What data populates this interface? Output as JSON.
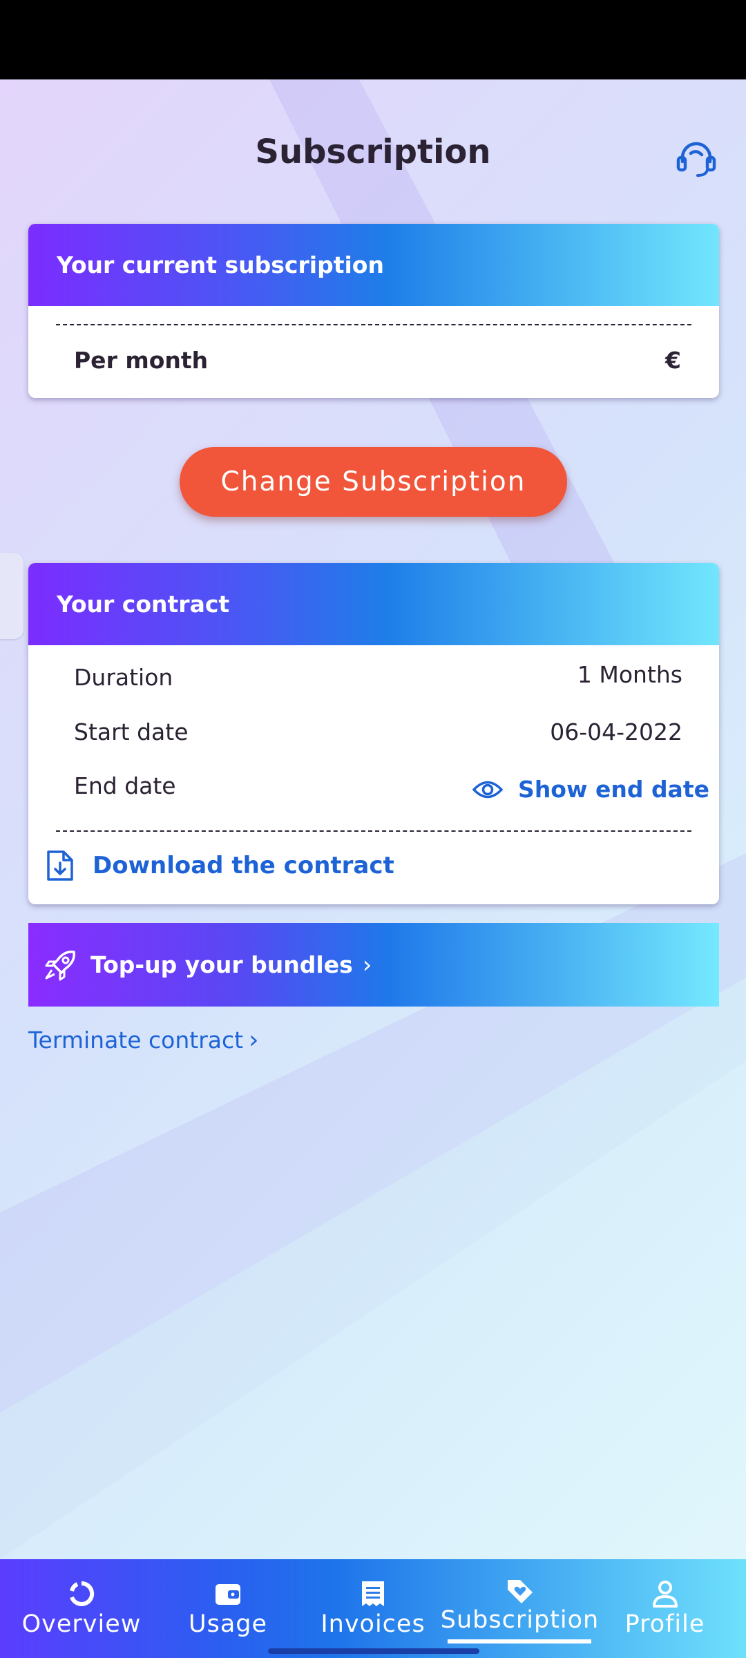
{
  "header": {
    "title": "Subscription",
    "support_icon": "headset-icon"
  },
  "current_subscription": {
    "heading": "Your current subscription",
    "per_month_label": "Per month",
    "per_month_value": "€"
  },
  "change_button": {
    "label": "Change Subscription"
  },
  "contract": {
    "heading": "Your contract",
    "duration_label": "Duration",
    "duration_value": "1 Months",
    "start_label": "Start date",
    "start_value": "06-04-2022",
    "end_label": "End date",
    "show_end_label": "Show end date",
    "download_label": "Download the contract"
  },
  "topup": {
    "label": "Top-up your bundles",
    "chevron": "›"
  },
  "terminate": {
    "label": "Terminate contract",
    "chevron": "›"
  },
  "bottom_nav": {
    "items": [
      {
        "label": "Overview",
        "icon": "overview-icon"
      },
      {
        "label": "Usage",
        "icon": "wallet-icon"
      },
      {
        "label": "Invoices",
        "icon": "receipt-icon"
      },
      {
        "label": "Subscription",
        "icon": "tag-heart-icon",
        "active": true
      },
      {
        "label": "Profile",
        "icon": "person-icon"
      }
    ]
  },
  "colors": {
    "accent": "#1e63d6",
    "cta": "#f1553a",
    "heading_text": "#2b2233"
  }
}
